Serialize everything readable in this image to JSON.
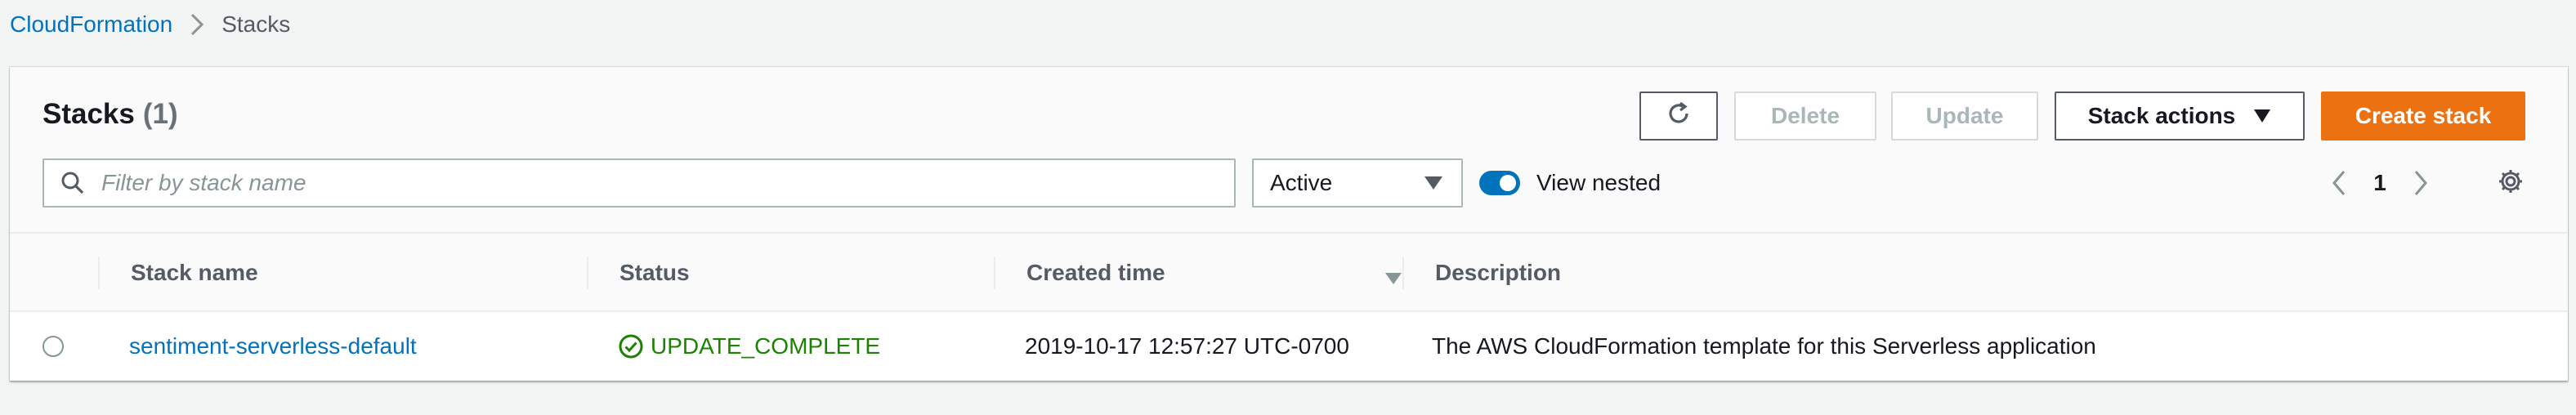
{
  "breadcrumb": {
    "root": "CloudFormation",
    "current": "Stacks"
  },
  "panel": {
    "title": "Stacks",
    "count": "(1)"
  },
  "toolbar": {
    "refresh_icon": "refresh-icon",
    "delete_label": "Delete",
    "update_label": "Update",
    "actions_label": "Stack actions",
    "create_label": "Create stack"
  },
  "filter": {
    "placeholder": "Filter by stack name",
    "value": "",
    "status_selected": "Active",
    "view_nested_label": "View nested",
    "view_nested_enabled": true
  },
  "pagination": {
    "current_page": "1"
  },
  "table": {
    "columns": [
      "Stack name",
      "Status",
      "Created time",
      "Description"
    ],
    "sorted_column": "Created time",
    "rows": [
      {
        "stack_name": "sentiment-serverless-default",
        "status": "UPDATE_COMPLETE",
        "created_time": "2019-10-17 12:57:27 UTC-0700",
        "description": "The AWS CloudFormation template for this Serverless application"
      }
    ]
  },
  "colors": {
    "link": "#0073bb",
    "primary_button": "#ec7211",
    "status_success": "#1d8102",
    "toggle_on": "#0073bb"
  }
}
